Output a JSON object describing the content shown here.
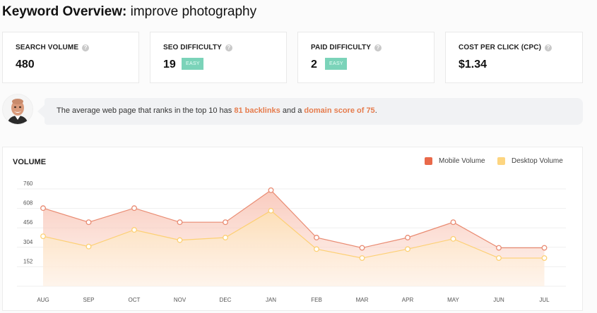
{
  "header": {
    "title_bold": "Keyword Overview:",
    "title_keyword": "improve photography"
  },
  "cards": [
    {
      "label": "SEARCH VOLUME",
      "value": "480",
      "badge": ""
    },
    {
      "label": "SEO DIFFICULTY",
      "value": "19",
      "badge": "EASY"
    },
    {
      "label": "PAID DIFFICULTY",
      "value": "2",
      "badge": "EASY"
    },
    {
      "label": "COST PER CLICK (CPC)",
      "value": "$1.34",
      "badge": ""
    }
  ],
  "tip": {
    "part1": "The average web page that ranks in the top 10 has ",
    "highlight1": "81 backlinks",
    "part2": " and a ",
    "highlight2": "domain score of 75",
    "part3": "."
  },
  "volume": {
    "title": "VOLUME",
    "legend_mobile": "Mobile Volume",
    "legend_desktop": "Desktop Volume",
    "colors": {
      "mobile": "#e9694a",
      "desktop": "#fdd580",
      "badge": "#7bd3b9",
      "highlight": "#e67c4d"
    }
  },
  "chart_data": {
    "type": "area",
    "categories": [
      "AUG",
      "SEP",
      "OCT",
      "NOV",
      "DEC",
      "JAN",
      "FEB",
      "MAR",
      "APR",
      "MAY",
      "JUN",
      "JUL"
    ],
    "y_ticks": [
      152,
      304,
      456,
      608,
      760
    ],
    "ylim": [
      0,
      760
    ],
    "series": [
      {
        "name": "Mobile Volume",
        "values": [
          610,
          500,
          610,
          500,
          500,
          750,
          380,
          300,
          380,
          500,
          300,
          300
        ]
      },
      {
        "name": "Desktop Volume",
        "values": [
          390,
          310,
          440,
          360,
          380,
          590,
          290,
          220,
          290,
          370,
          220,
          220
        ]
      }
    ],
    "grid": true,
    "legend": "top-right"
  }
}
